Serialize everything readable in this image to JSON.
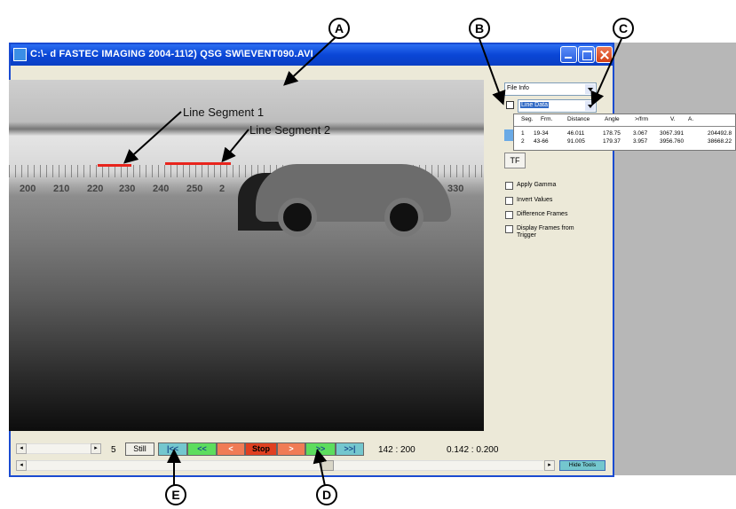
{
  "window": {
    "title": "C:\\-  d FASTEC IMAGING 2004-11\\2) QSG SW\\EVENT090.AVI"
  },
  "video": {
    "ruler_numbers": [
      "200",
      "210",
      "220",
      "230",
      "240",
      "250",
      "2",
      "320",
      "330"
    ],
    "segment_labels": [
      "Line Segment 1",
      "Line Segment 2"
    ]
  },
  "tools": {
    "info_dropdown": "File Info",
    "data_dropdown": "Line Data",
    "table": {
      "headers": [
        "Seg.",
        "Frm.",
        "Distance",
        "Angle",
        ">/frm",
        "V.",
        "A."
      ],
      "rows": [
        [
          "1",
          "19-34",
          "46.011",
          "178.75",
          "3.067",
          "3067.391",
          "204492.8"
        ],
        [
          "2",
          "43-66",
          "91.005",
          "179.37",
          "3.957",
          "3956.760",
          "38668.22"
        ]
      ]
    },
    "tf_label": "TF",
    "checkboxes": [
      "Apply Gamma",
      "Invert Values",
      "Difference Frames",
      "Display Frames from Trigger"
    ]
  },
  "controls": {
    "speed_value": "5",
    "still_label": "Still",
    "buttons": [
      "|<<",
      "<<",
      "<",
      "Stop",
      ">",
      ">>",
      ">>|"
    ],
    "frame_counter": "142 : 200",
    "time_counter": "0.142 : 0.200",
    "hide_tools_label": "Hide Tools"
  },
  "callouts": [
    "A",
    "B",
    "C",
    "D",
    "E"
  ],
  "colors": {
    "titlebar": "#0a46d6",
    "line_segment": "#e8241c",
    "teal_button": "#74c7ce",
    "green_button": "#5ddd5d",
    "orange_button": "#f07c55",
    "stop_button": "#e04020"
  }
}
